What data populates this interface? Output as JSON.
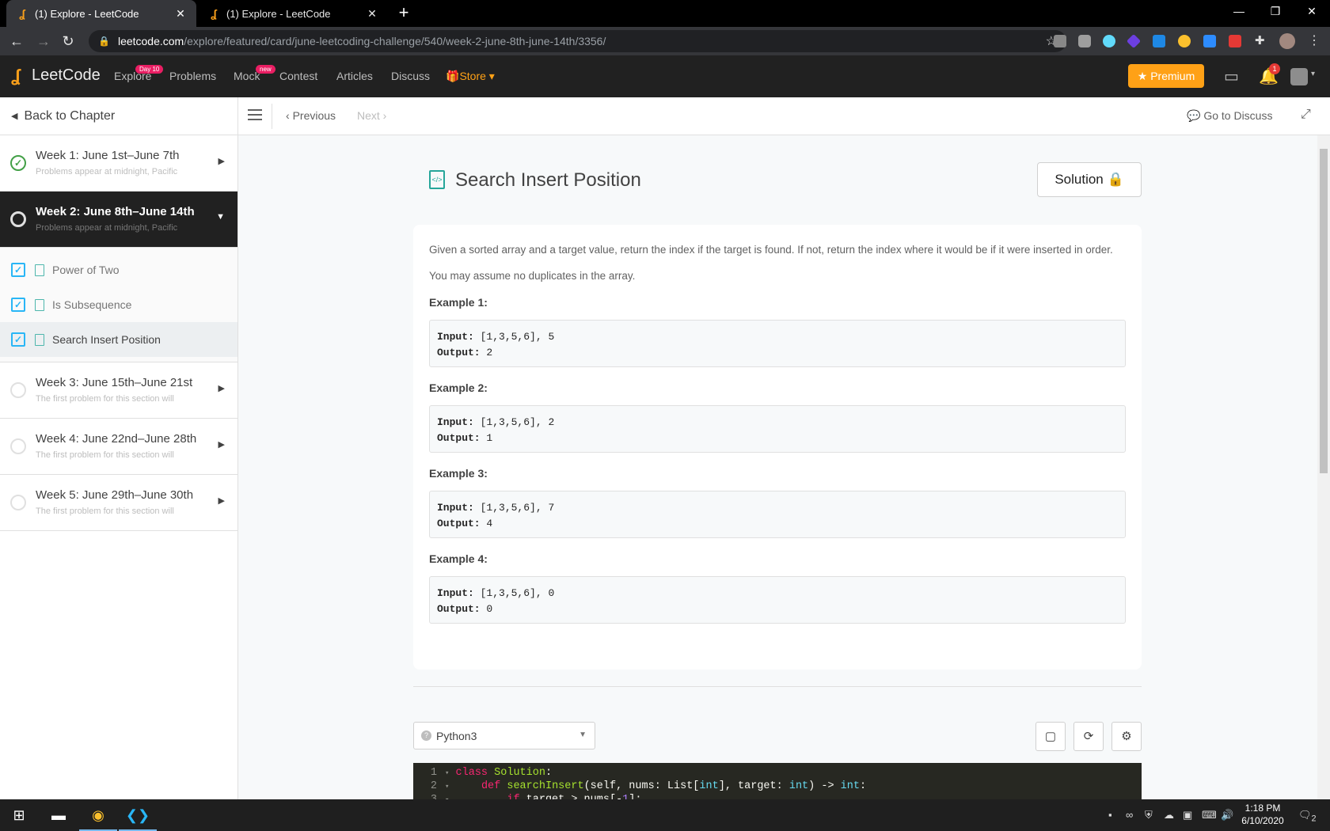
{
  "browser": {
    "tabs": [
      {
        "title": "(1) Explore - LeetCode"
      },
      {
        "title": "(1) Explore - LeetCode"
      }
    ],
    "url_host": "leetcode.com",
    "url_path": "/explore/featured/card/june-leetcoding-challenge/540/week-2-june-8th-june-14th/3356/"
  },
  "nav": {
    "logo": "LeetCode",
    "links": [
      "Explore",
      "Problems",
      "Mock",
      "Contest",
      "Articles",
      "Discuss"
    ],
    "explore_badge": "Day 10",
    "mock_badge": "new",
    "store": "Store",
    "premium": "Premium",
    "notification_count": "1"
  },
  "sidebar": {
    "back": "Back to Chapter",
    "chapters": [
      {
        "title": "Week 1: June 1st–June 7th",
        "subtitle": "Problems appear at midnight, Pacific",
        "status": "done"
      },
      {
        "title": "Week 2: June 8th–June 14th",
        "subtitle": "Problems appear at midnight, Pacific",
        "status": "active"
      },
      {
        "title": "Week 3: June 15th–June 21st",
        "subtitle": "The first problem for this section will",
        "status": "todo"
      },
      {
        "title": "Week 4: June 22nd–June 28th",
        "subtitle": "The first problem for this section will",
        "status": "todo"
      },
      {
        "title": "Week 5: June 29th–June 30th",
        "subtitle": "The first problem for this section will",
        "status": "todo"
      }
    ],
    "items": [
      "Power of Two",
      "Is Subsequence",
      "Search Insert Position"
    ]
  },
  "toolbar": {
    "previous": "Previous",
    "next": "Next",
    "discuss": "Go to Discuss"
  },
  "problem": {
    "title": "Search Insert Position",
    "solution_label": "Solution",
    "description": "Given a sorted array and a target value, return the index if the target is found. If not, return the index where it would be if it were inserted in order.",
    "note": "You may assume no duplicates in the array.",
    "examples": [
      {
        "label": "Example 1:",
        "input": "[1,3,5,6], 5",
        "output": "2"
      },
      {
        "label": "Example 2:",
        "input": "[1,3,5,6], 2",
        "output": "1"
      },
      {
        "label": "Example 3:",
        "input": "[1,3,5,6], 7",
        "output": "4"
      },
      {
        "label": "Example 4:",
        "input": "[1,3,5,6], 0",
        "output": "0"
      }
    ],
    "input_label": "Input:",
    "output_label": "Output:"
  },
  "editor": {
    "language": "Python3",
    "line1_no": "1",
    "line2_no": "2",
    "line3_no": "3"
  },
  "taskbar": {
    "time": "1:18 PM",
    "date": "6/10/2020",
    "notification_count": "2"
  },
  "colors": {
    "brand": "#ffa116",
    "nav_bg": "#212121",
    "check": "#29b6f6",
    "done": "#43a047"
  }
}
